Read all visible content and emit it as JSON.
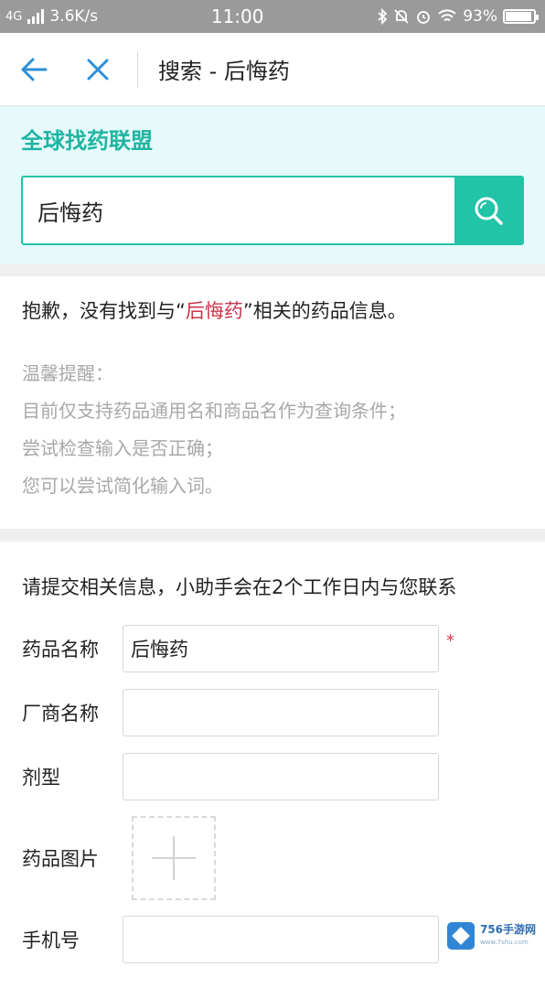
{
  "status_bar": {
    "network": "4G",
    "speed": "3.6K/s",
    "time": "11:00",
    "battery": "93%",
    "battery_level": 0.93
  },
  "nav": {
    "title": "搜索 - 后悔药",
    "icons": [
      "back-arrow-icon",
      "close-icon"
    ]
  },
  "search": {
    "alliance_title": "全球找药联盟",
    "query": "后悔药",
    "accent_color": "#22c4a8"
  },
  "result": {
    "sorry_prefix": "抱歉，没有找到与“",
    "keyword": "后悔药",
    "sorry_suffix": "”相关的药品信息。",
    "tips": [
      "温馨提醒：",
      "目前仅支持药品通用名和商品名作为查询条件；",
      "尝试检查输入是否正确；",
      "您可以尝试简化输入词。"
    ]
  },
  "form": {
    "intro": "请提交相关信息，小助手会在2个工作日内与您联系",
    "fields": [
      {
        "label": "药品名称",
        "value": "后悔药",
        "required_mark": "*"
      },
      {
        "label": "厂商名称",
        "value": ""
      },
      {
        "label": "剂型",
        "value": ""
      },
      {
        "label": "药品图片",
        "value": ""
      },
      {
        "label": "手机号",
        "value": ""
      }
    ]
  },
  "watermark": {
    "text": "756手游网",
    "sub": "www.7shu.com"
  }
}
